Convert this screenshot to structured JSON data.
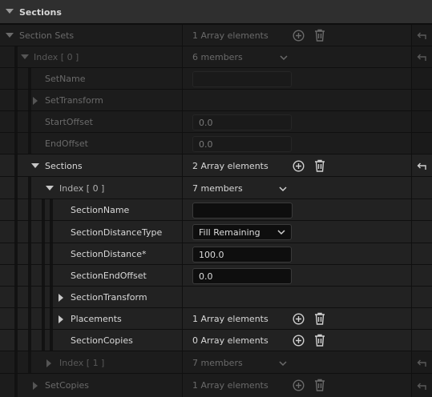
{
  "header": {
    "title": "Sections"
  },
  "section_sets": {
    "label": "Section Sets",
    "value": "1 Array elements"
  },
  "index0": {
    "label": "Index [ 0 ]",
    "value": "6 members"
  },
  "set_name": {
    "label": "SetName",
    "value": ""
  },
  "set_transform": {
    "label": "SetTransform"
  },
  "start_offset": {
    "label": "StartOffset",
    "value": "0.0"
  },
  "end_offset": {
    "label": "EndOffset",
    "value": "0.0"
  },
  "sections": {
    "label": "Sections",
    "value": "2 Array elements"
  },
  "sections_index0": {
    "label": "Index [ 0 ]",
    "value": "7 members"
  },
  "section_name": {
    "label": "SectionName",
    "value": ""
  },
  "section_distance_type": {
    "label": "SectionDistanceType",
    "value": "Fill Remaining"
  },
  "section_distance": {
    "label": "SectionDistance*",
    "value": "100.0"
  },
  "section_end_offset": {
    "label": "SectionEndOffset",
    "value": "0.0"
  },
  "section_transform": {
    "label": "SectionTransform"
  },
  "placements": {
    "label": "Placements",
    "value": "1 Array elements"
  },
  "section_copies": {
    "label": "SectionCopies",
    "value": "0 Array elements"
  },
  "sections_index1": {
    "label": "Index [ 1 ]",
    "value": "7 members"
  },
  "set_copies": {
    "label": "SetCopies",
    "value": "1 Array elements"
  }
}
